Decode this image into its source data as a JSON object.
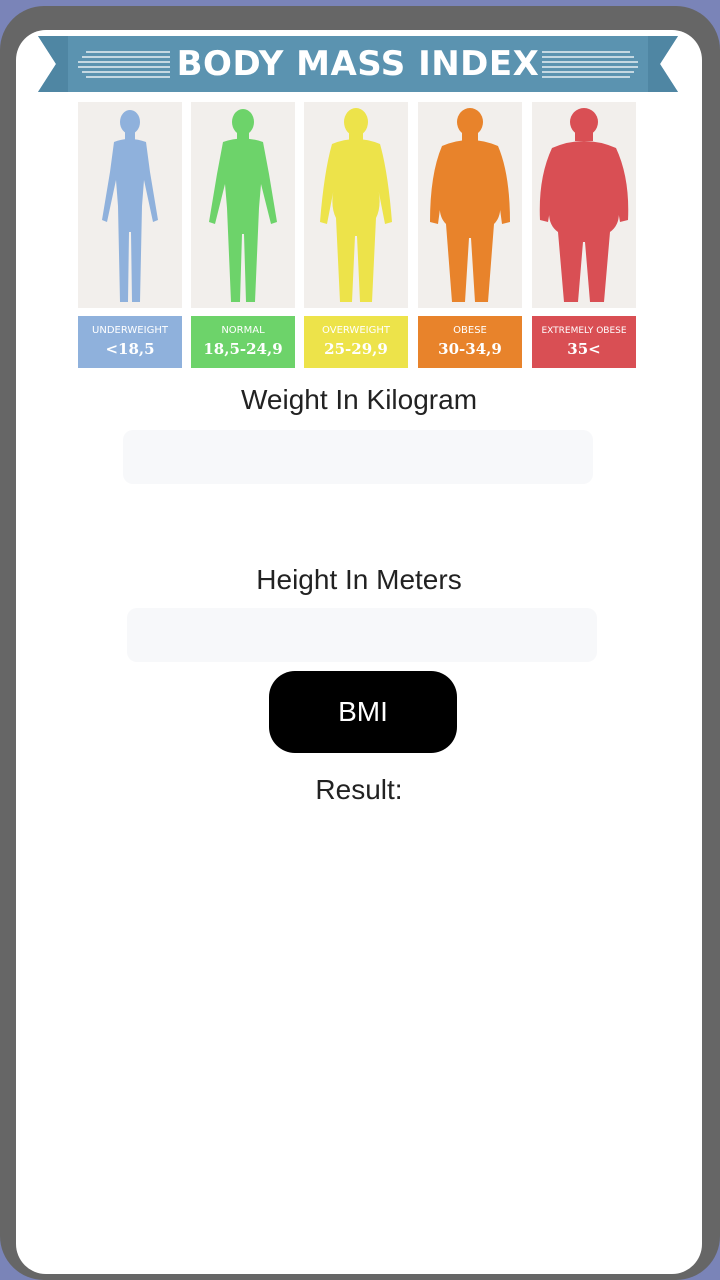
{
  "header": {
    "title": "BODY MASS INDEX",
    "banner_color": "#5b93b0"
  },
  "categories": [
    {
      "name": "UNDERWEIGHT",
      "range": "<18,5",
      "color": "#8fb1dc",
      "icon": "person-slim-icon"
    },
    {
      "name": "NORMAL",
      "range": "18,5-24,9",
      "color": "#6dd36a",
      "icon": "person-normal-icon"
    },
    {
      "name": "OVERWEIGHT",
      "range": "25-29,9",
      "color": "#ede34a",
      "icon": "person-overweight-icon"
    },
    {
      "name": "OBESE",
      "range": "30-34,9",
      "color": "#e8832b",
      "icon": "person-obese-icon"
    },
    {
      "name": "EXTREMELY OBESE",
      "range": "35<",
      "color": "#d94f54",
      "icon": "person-extremely-obese-icon"
    }
  ],
  "form": {
    "weight_label": "Weight In Kilogram",
    "weight_value": "",
    "height_label": "Height In Meters",
    "height_value": "",
    "button_label": "BMI",
    "result_label": "Result:"
  }
}
